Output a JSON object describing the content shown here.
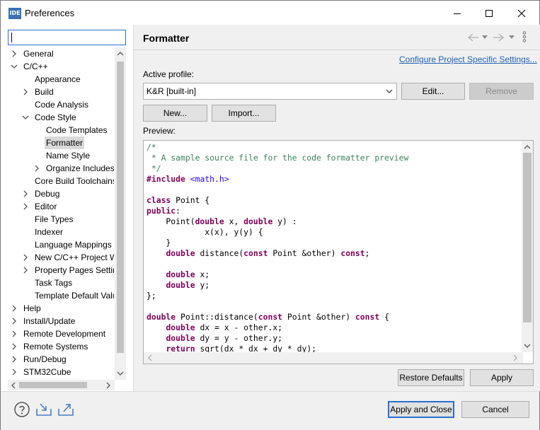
{
  "window": {
    "icon_text": "IDE",
    "title": "Preferences"
  },
  "left": {
    "filter_value": "",
    "tree": [
      {
        "label": "General",
        "level": 0,
        "toggle": "collapsed"
      },
      {
        "label": "C/C++",
        "level": 0,
        "toggle": "expanded"
      },
      {
        "label": "Appearance",
        "level": 1,
        "toggle": "none"
      },
      {
        "label": "Build",
        "level": 1,
        "toggle": "collapsed"
      },
      {
        "label": "Code Analysis",
        "level": 1,
        "toggle": "none"
      },
      {
        "label": "Code Style",
        "level": 1,
        "toggle": "expanded"
      },
      {
        "label": "Code Templates",
        "level": 2,
        "toggle": "none"
      },
      {
        "label": "Formatter",
        "level": 2,
        "toggle": "none",
        "selected": true
      },
      {
        "label": "Name Style",
        "level": 2,
        "toggle": "none"
      },
      {
        "label": "Organize Includes",
        "level": 2,
        "toggle": "collapsed"
      },
      {
        "label": "Core Build Toolchains",
        "level": 1,
        "toggle": "none"
      },
      {
        "label": "Debug",
        "level": 1,
        "toggle": "collapsed"
      },
      {
        "label": "Editor",
        "level": 1,
        "toggle": "collapsed"
      },
      {
        "label": "File Types",
        "level": 1,
        "toggle": "none"
      },
      {
        "label": "Indexer",
        "level": 1,
        "toggle": "none"
      },
      {
        "label": "Language Mappings",
        "level": 1,
        "toggle": "none"
      },
      {
        "label": "New C/C++ Project Wizard",
        "level": 1,
        "toggle": "collapsed"
      },
      {
        "label": "Property Pages Settings",
        "level": 1,
        "toggle": "collapsed"
      },
      {
        "label": "Task Tags",
        "level": 1,
        "toggle": "none"
      },
      {
        "label": "Template Default Values",
        "level": 1,
        "toggle": "none"
      },
      {
        "label": "Help",
        "level": 0,
        "toggle": "collapsed"
      },
      {
        "label": "Install/Update",
        "level": 0,
        "toggle": "collapsed"
      },
      {
        "label": "Remote Development",
        "level": 0,
        "toggle": "collapsed"
      },
      {
        "label": "Remote Systems",
        "level": 0,
        "toggle": "collapsed"
      },
      {
        "label": "Run/Debug",
        "level": 0,
        "toggle": "collapsed"
      },
      {
        "label": "STM32Cube",
        "level": 0,
        "toggle": "collapsed"
      }
    ]
  },
  "page": {
    "title": "Formatter",
    "configure_link": "Configure Project Specific Settings...",
    "active_profile_label": "Active profile:",
    "active_profile_value": "K&R [built-in]",
    "edit_label": "Edit...",
    "remove_label": "Remove",
    "new_label": "New...",
    "import_label": "Import...",
    "preview_label": "Preview:",
    "code_lines": [
      [
        {
          "t": "/*",
          "c": "com"
        }
      ],
      [
        {
          "t": " * A sample source file for the code formatter preview",
          "c": "com"
        }
      ],
      [
        {
          "t": " */",
          "c": "com"
        }
      ],
      [
        {
          "t": "#include",
          "c": "kw"
        },
        {
          "t": " ",
          "c": ""
        },
        {
          "t": "<math.h>",
          "c": "inc"
        }
      ],
      [
        {
          "t": "",
          "c": ""
        }
      ],
      [
        {
          "t": "class",
          "c": "kw"
        },
        {
          "t": " Point {",
          "c": ""
        }
      ],
      [
        {
          "t": "public",
          "c": "kw"
        },
        {
          "t": ":",
          "c": ""
        }
      ],
      [
        {
          "t": "    Point(",
          "c": ""
        },
        {
          "t": "double",
          "c": "kw"
        },
        {
          "t": " x, ",
          "c": ""
        },
        {
          "t": "double",
          "c": "kw"
        },
        {
          "t": " y) :",
          "c": ""
        }
      ],
      [
        {
          "t": "            x(x), y(y) {",
          "c": ""
        }
      ],
      [
        {
          "t": "    }",
          "c": ""
        }
      ],
      [
        {
          "t": "    ",
          "c": ""
        },
        {
          "t": "double",
          "c": "kw"
        },
        {
          "t": " distance(",
          "c": ""
        },
        {
          "t": "const",
          "c": "kw"
        },
        {
          "t": " Point &other) ",
          "c": ""
        },
        {
          "t": "const",
          "c": "kw"
        },
        {
          "t": ";",
          "c": ""
        }
      ],
      [
        {
          "t": "",
          "c": ""
        }
      ],
      [
        {
          "t": "    ",
          "c": ""
        },
        {
          "t": "double",
          "c": "kw"
        },
        {
          "t": " x;",
          "c": ""
        }
      ],
      [
        {
          "t": "    ",
          "c": ""
        },
        {
          "t": "double",
          "c": "kw"
        },
        {
          "t": " y;",
          "c": ""
        }
      ],
      [
        {
          "t": "};",
          "c": ""
        }
      ],
      [
        {
          "t": "",
          "c": ""
        }
      ],
      [
        {
          "t": "double",
          "c": "kw"
        },
        {
          "t": " Point::distance(",
          "c": ""
        },
        {
          "t": "const",
          "c": "kw"
        },
        {
          "t": " Point &other) ",
          "c": ""
        },
        {
          "t": "const",
          "c": "kw"
        },
        {
          "t": " {",
          "c": ""
        }
      ],
      [
        {
          "t": "    ",
          "c": ""
        },
        {
          "t": "double",
          "c": "kw"
        },
        {
          "t": " dx = x - other.x;",
          "c": ""
        }
      ],
      [
        {
          "t": "    ",
          "c": ""
        },
        {
          "t": "double",
          "c": "kw"
        },
        {
          "t": " dy = y - other.y;",
          "c": ""
        }
      ],
      [
        {
          "t": "    ",
          "c": ""
        },
        {
          "t": "return",
          "c": "kw"
        },
        {
          "t": " sqrt(dx * dx + dy * dy);",
          "c": ""
        }
      ]
    ],
    "restore_defaults_label": "Restore Defaults",
    "apply_label": "Apply"
  },
  "footer": {
    "apply_close_label": "Apply and Close",
    "cancel_label": "Cancel"
  },
  "colors": {
    "accent": "#2b6fcf",
    "link": "#1f5fb4",
    "comment": "#3f7f5f",
    "keyword": "#7f0055",
    "string": "#2a00ff"
  }
}
